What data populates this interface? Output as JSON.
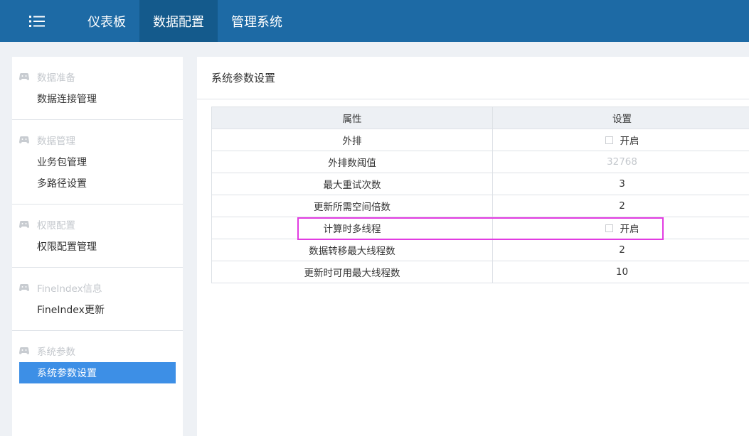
{
  "topbar": {
    "menu_icon": "list-menu-icon",
    "tabs": [
      {
        "label": "仪表板",
        "active": false
      },
      {
        "label": "数据配置",
        "active": true
      },
      {
        "label": "管理系统",
        "active": false
      }
    ]
  },
  "sidebar": {
    "group_icon": "gamepad-icon",
    "groups": [
      {
        "title": "数据准备",
        "items": [
          {
            "label": "数据连接管理",
            "active": false
          }
        ]
      },
      {
        "title": "数据管理",
        "items": [
          {
            "label": "业务包管理",
            "active": false
          },
          {
            "label": "多路径设置",
            "active": false
          }
        ]
      },
      {
        "title": "权限配置",
        "items": [
          {
            "label": "权限配置管理",
            "active": false
          }
        ]
      },
      {
        "title": "FineIndex信息",
        "items": [
          {
            "label": "FineIndex更新",
            "active": false
          }
        ]
      },
      {
        "title": "系统参数",
        "items": [
          {
            "label": "系统参数设置",
            "active": true
          }
        ]
      }
    ]
  },
  "main": {
    "title": "系统参数设置",
    "table": {
      "headers": [
        "属性",
        "设置"
      ],
      "rows": [
        {
          "attr": "外排",
          "type": "checkbox",
          "value": "开启",
          "checked": false
        },
        {
          "attr": "外排数阈值",
          "type": "text-faded",
          "value": "32768"
        },
        {
          "attr": "最大重试次数",
          "type": "text",
          "value": "3"
        },
        {
          "attr": "更新所需空间倍数",
          "type": "text",
          "value": "2"
        },
        {
          "attr": "计算时多线程",
          "type": "checkbox",
          "value": "开启",
          "checked": false
        },
        {
          "attr": "数据转移最大线程数",
          "type": "text",
          "value": "2"
        },
        {
          "attr": "更新时可用最大线程数",
          "type": "text",
          "value": "10"
        }
      ]
    }
  },
  "colors": {
    "topbar": "#1d6aa5",
    "topbar_active": "#145a8c",
    "sidebar_active": "#3d8fe6",
    "highlight_box": "#e23ce2"
  }
}
